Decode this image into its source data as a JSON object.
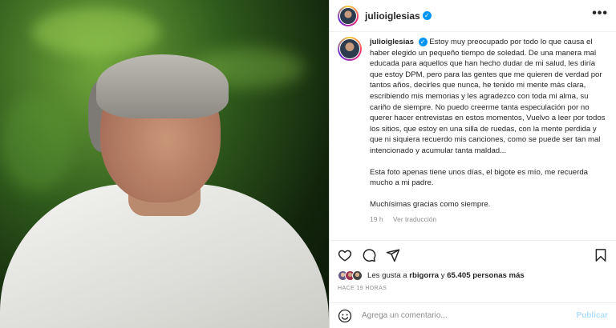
{
  "post": {
    "username": "julioiglesias",
    "verified_mark": "✓",
    "more_icon": "•••",
    "caption_paragraphs": [
      "Estoy muy preocupado por todo lo que causa el haber elegido un pequeño tiempo de soledad. De una manera mal educada para aquellos que han hecho dudar de mi salud, les diría que estoy DPM, pero para las gentes que me quieren de verdad por tantos años, decirles que nunca, he tenido mi mente más clara, escribiendo mis memorias y les agradezco con toda mi alma, su cariño de siempre. No puedo creerme tanta especulación por no querer hacer entrevistas en estos momentos, Vuelvo a leer por todos los sitios, que estoy en una silla de ruedas, con la mente perdida y que ni siquiera recuerdo mis canciones, como se puede ser tan mal intencionado y acumular tanta maldad...",
      "Esta foto apenas tiene unos días, el bigote es mío, me recuerda mucho a mi padre.",
      "Muchísimas gracias como siempre."
    ],
    "time": "19 h",
    "translate_label": "Ver traducción",
    "likes_prefix": "Les gusta a ",
    "likes_user": "rbigorra",
    "likes_middle": " y ",
    "likes_count": "65.405 personas más",
    "timeago": "HACE 19 HORAS",
    "comment_placeholder": "Agrega un comentario...",
    "post_label": "Publicar"
  },
  "icons": {
    "like": "heart-icon",
    "comment": "comment-icon",
    "share": "share-icon",
    "save": "bookmark-icon",
    "emoji": "emoji-icon"
  },
  "colors": {
    "accent": "#0095f6",
    "post_disabled": "#b2dffc",
    "muted": "#8e8e8e"
  }
}
